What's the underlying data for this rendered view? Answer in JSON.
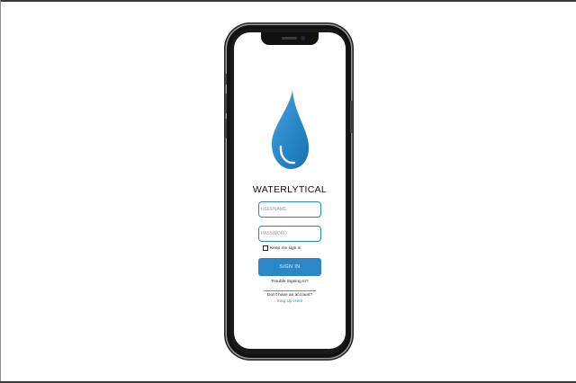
{
  "app": {
    "title": "WATERLYTICAL",
    "logo": "water-drop-icon",
    "accent_color": "#2b86c8"
  },
  "form": {
    "username_placeholder": "USERNAME",
    "password_placeholder": "PASSWORD",
    "keep_signed_in_label": "Keep me sign in",
    "keep_signed_in_checked": false,
    "signin_label": "SIGN IN"
  },
  "links": {
    "trouble": "Trouble Signing In?",
    "no_account": "Don't have an account?",
    "signup": "Sing Up Here"
  }
}
